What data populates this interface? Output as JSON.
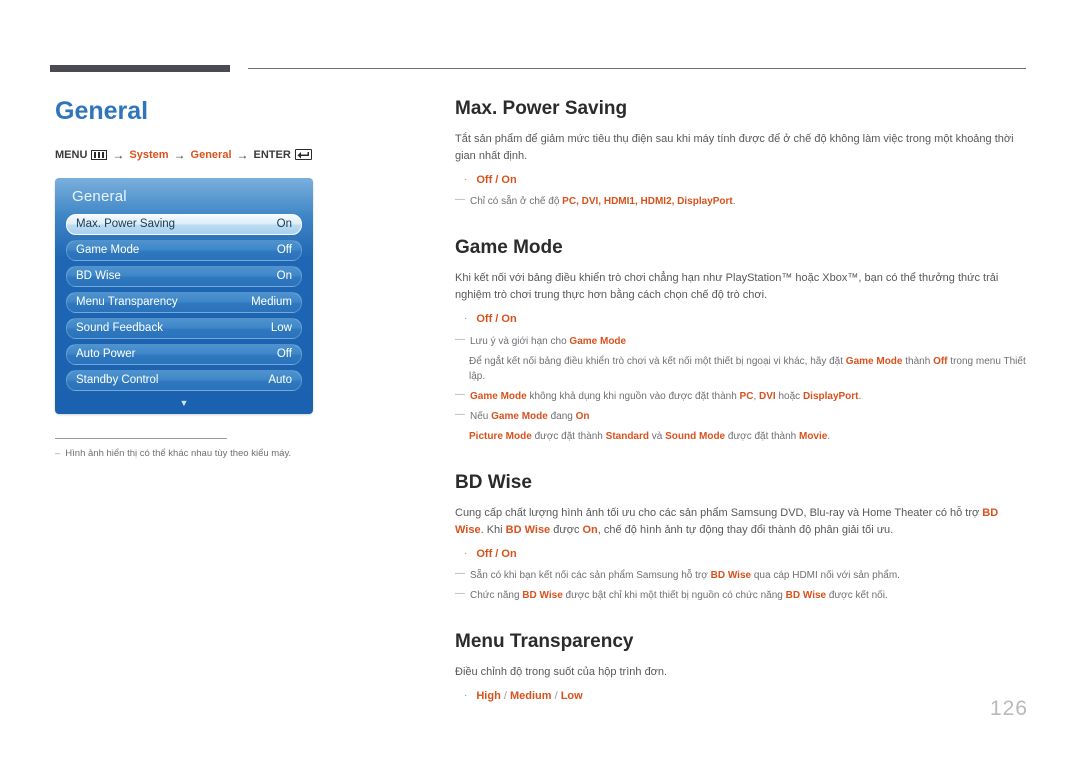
{
  "page_title": "General",
  "breadcrumb": {
    "menu_label": "MENU",
    "menu_icon": "menu-bars-icon",
    "arrow": "→",
    "item1": "System",
    "item2": "General",
    "enter_label": "ENTER",
    "enter_icon": "enter-return-icon"
  },
  "osd": {
    "title": "General",
    "rows": [
      {
        "label": "Max. Power Saving",
        "value": "On",
        "selected": true
      },
      {
        "label": "Game Mode",
        "value": "Off",
        "selected": false
      },
      {
        "label": "BD Wise",
        "value": "On",
        "selected": false
      },
      {
        "label": "Menu Transparency",
        "value": "Medium",
        "selected": false
      },
      {
        "label": "Sound Feedback",
        "value": "Low",
        "selected": false
      },
      {
        "label": "Auto Power",
        "value": "Off",
        "selected": false
      },
      {
        "label": "Standby Control",
        "value": "Auto",
        "selected": false
      }
    ],
    "scroll_arrow": "▼"
  },
  "left_note": {
    "dash": "‒",
    "text": "Hình ảnh hiển thị có thể khác nhau tùy theo kiểu máy."
  },
  "sections": {
    "max_power_saving": {
      "title": "Max. Power Saving",
      "paragraph": "Tắt sản phẩm để giảm mức tiêu thụ điện sau khi máy tính được để ở chế độ không làm việc trong một khoảng thời gian nhất định.",
      "bullet_dot": "·",
      "bullet": "Off / On",
      "note_dash": "—",
      "note_prefix": "Chỉ có sẵn ở chế độ ",
      "note_modes": "PC, DVI, HDMI1, HDMI2, DisplayPort",
      "note_suffix": "."
    },
    "game_mode": {
      "title": "Game Mode",
      "paragraph": "Khi kết nối với bảng điều khiển trò chơi chẳng hạn như PlayStation™ hoặc Xbox™, bạn có thể thưởng thức trải nghiệm trò chơi trung thực hơn bằng cách chọn chế độ trò chơi.",
      "bullet_dot": "·",
      "bullet": "Off / On",
      "note1_dash": "—",
      "note1_a": "Lưu ý và giới hạn cho ",
      "note1_b": "Game Mode",
      "note1_sub_a": "Để ngắt kết nối bảng điều khiển trò chơi và kết nối một thiết bị ngoại vi khác, hãy đặt ",
      "note1_sub_b": "Game Mode",
      "note1_sub_c": " thành ",
      "note1_sub_d": "Off",
      "note1_sub_e": " trong menu Thiết lập.",
      "note2_dash": "—",
      "note2_a": "Game Mode",
      "note2_b": " không khả dụng khi nguồn vào được đặt thành ",
      "note2_c": "PC",
      "note2_d": ", ",
      "note2_e": "DVI",
      "note2_f": " hoặc ",
      "note2_g": "DisplayPort",
      "note2_h": ".",
      "note3_dash": "—",
      "note3_a": "Nếu ",
      "note3_b": "Game Mode",
      "note3_c": " đang ",
      "note3_d": "On",
      "note3_sub_a": "Picture Mode",
      "note3_sub_b": " được đặt thành ",
      "note3_sub_c": "Standard",
      "note3_sub_d": " và ",
      "note3_sub_e": "Sound Mode",
      "note3_sub_f": " được đặt thành ",
      "note3_sub_g": "Movie",
      "note3_sub_h": "."
    },
    "bd_wise": {
      "title": "BD Wise",
      "para_a": "Cung cấp chất lượng hình ảnh tối ưu cho các sản phẩm Samsung DVD, Blu-ray và Home Theater có hỗ trợ ",
      "para_b": "BD Wise",
      "para_c": ". Khi ",
      "para_d": "BD Wise",
      "para_e": " được ",
      "para_f": "On",
      "para_g": ", chế độ hình ảnh tự động thay đổi thành độ phân giải tối ưu.",
      "bullet_dot": "·",
      "bullet": "Off / On",
      "note1_dash": "—",
      "note1_a": "Sẵn có khi bạn kết nối các sản phẩm Samsung hỗ trợ ",
      "note1_b": "BD Wise",
      "note1_c": " qua cáp HDMI nối với sản phẩm.",
      "note2_dash": "—",
      "note2_a": "Chức năng ",
      "note2_b": "BD Wise",
      "note2_c": " được bật chỉ khi một thiết bị nguồn có chức năng ",
      "note2_d": "BD Wise",
      "note2_e": " được kết nối."
    },
    "menu_transparency": {
      "title": "Menu Transparency",
      "paragraph": "Điều chỉnh độ trong suốt của hộp trình đơn.",
      "bullet_dot": "·",
      "bullet_high": "High",
      "bullet_sep1": " / ",
      "bullet_medium": "Medium",
      "bullet_sep2": " / ",
      "bullet_low": "Low"
    }
  },
  "page_number": "126",
  "colors": {
    "heading_blue": "#2e75bb",
    "accent_orange": "#d8521e",
    "body_gray": "#58585a",
    "rule_dark": "#4a4a55",
    "osd_blue": "#1f66b4"
  }
}
